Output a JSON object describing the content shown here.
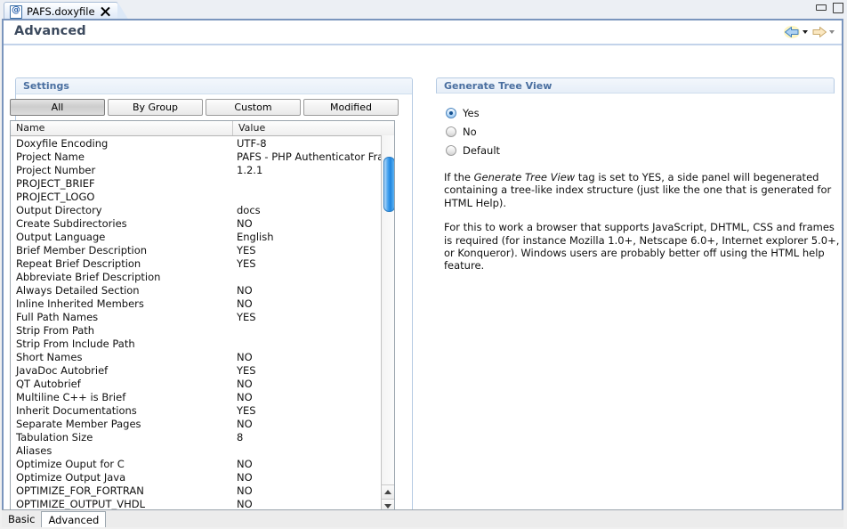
{
  "window": {
    "tab_title": "PAFS.doxyfile",
    "doc_icon": "doxyfile-document-icon",
    "close_icon": "close-icon",
    "minimize_icon": "minimize-icon",
    "maximize_icon": "maximize-icon"
  },
  "page": {
    "title": "Advanced",
    "back_icon": "back-arrow-icon",
    "forward_icon": "forward-arrow-icon",
    "accent": "#7a95bd",
    "header_color": "#3c4a5e"
  },
  "settings": {
    "group_label": "Settings",
    "filters": [
      {
        "label": "All",
        "active": true
      },
      {
        "label": "By Group",
        "active": false
      },
      {
        "label": "Custom",
        "active": false
      },
      {
        "label": "Modified",
        "active": false
      }
    ],
    "columns": [
      "Name",
      "Value"
    ],
    "rows": [
      {
        "name": "Doxyfile Encoding",
        "value": "UTF-8"
      },
      {
        "name": "Project Name",
        "value": "PAFS - PHP Authenticator Frame"
      },
      {
        "name": "Project Number",
        "value": "1.2.1"
      },
      {
        "name": "PROJECT_BRIEF",
        "value": ""
      },
      {
        "name": "PROJECT_LOGO",
        "value": ""
      },
      {
        "name": "Output Directory",
        "value": "docs"
      },
      {
        "name": "Create Subdirectories",
        "value": "NO"
      },
      {
        "name": "Output Language",
        "value": "English"
      },
      {
        "name": "Brief Member Description",
        "value": "YES"
      },
      {
        "name": "Repeat Brief Description",
        "value": "YES"
      },
      {
        "name": "Abbreviate Brief Description",
        "value": ""
      },
      {
        "name": "Always Detailed Section",
        "value": "NO"
      },
      {
        "name": "Inline Inherited Members",
        "value": "NO"
      },
      {
        "name": "Full Path Names",
        "value": "YES"
      },
      {
        "name": "Strip From Path",
        "value": ""
      },
      {
        "name": "Strip From Include Path",
        "value": ""
      },
      {
        "name": "Short Names",
        "value": "NO"
      },
      {
        "name": "JavaDoc Autobrief",
        "value": "YES"
      },
      {
        "name": "QT Autobrief",
        "value": "NO"
      },
      {
        "name": "Multiline C++ is Brief",
        "value": "NO"
      },
      {
        "name": "Inherit Documentations",
        "value": "YES"
      },
      {
        "name": "Separate Member Pages",
        "value": "NO"
      },
      {
        "name": "Tabulation Size",
        "value": "8"
      },
      {
        "name": "Aliases",
        "value": ""
      },
      {
        "name": "Optimize Ouput for C",
        "value": "NO"
      },
      {
        "name": "Optimize Output Java",
        "value": "NO"
      },
      {
        "name": "OPTIMIZE_FOR_FORTRAN",
        "value": "NO"
      },
      {
        "name": "OPTIMIZE_OUTPUT_VHDL",
        "value": "NO"
      }
    ]
  },
  "detail": {
    "title": "Generate Tree View",
    "options": [
      {
        "label": "Yes",
        "selected": true
      },
      {
        "label": "No",
        "selected": false
      },
      {
        "label": "Default",
        "selected": false
      }
    ],
    "paragraph1_a": "If the ",
    "paragraph1_em": "Generate Tree View",
    "paragraph1_b": " tag is set to  YES, a side panel will begenerated containing a tree-like index structure (just like the one that is generated for HTML Help).",
    "paragraph2": "For this to work a browser that supports JavaScript, DHTML, CSS and frames is required (for instance Mozilla 1.0+, Netscape 6.0+, Internet explorer 5.0+, or Konqueror). Windows users are probably better off using the HTML help feature."
  },
  "bottom_tabs": [
    {
      "label": "Basic",
      "selected": false
    },
    {
      "label": "Advanced",
      "selected": true
    }
  ]
}
